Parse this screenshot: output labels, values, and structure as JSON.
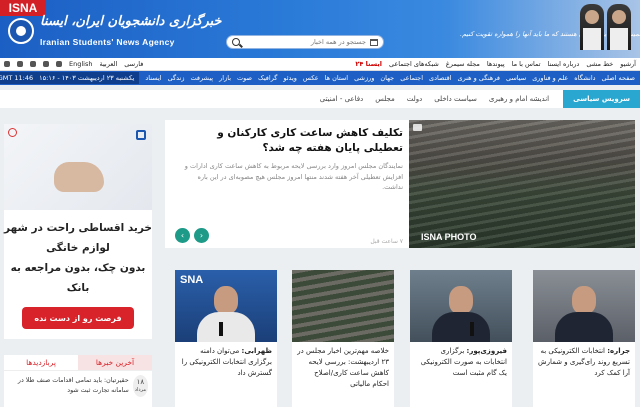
{
  "header": {
    "logo_text": "ISNA",
    "site_name_fa": "خبرگزاری دانشجویان ایران، ایسنا",
    "site_name_en": "Iranian Students' News Agency",
    "search_placeholder": "جستجو در همه اخبار",
    "quote_text": "امام خمینی (ره): اینها طوری هستند که ما باید آنها را همواره تقویت کنیم."
  },
  "top_nav": {
    "items": [
      "آرشیو",
      "خط مشی",
      "درباره ایسنا",
      "تماس با ما",
      "پیوندها",
      "مجله سیمرغ",
      "شبکه‌های اجتماعی",
      "ایسنا ۲۴"
    ],
    "langs": [
      "English",
      "العربیة",
      "فارسی"
    ]
  },
  "main_nav": {
    "items": [
      "صفحه اصلی",
      "دانشگاه",
      "علم و فناوری",
      "سیاسی",
      "فرهنگی و هنری",
      "اقتصادی",
      "اجتماعی",
      "جهان",
      "ورزشی",
      "استان ها",
      "عکس",
      "ویدئو",
      "گرافیک",
      "صوت",
      "بازار",
      "پیشرفت",
      "زندگی",
      "ایسناد"
    ],
    "date_fa": "یکشنبه ۲۳ اردیبهشت ۱۴۰۳ - ۱۵:۱۶",
    "time_gmt": "GMT 11:46"
  },
  "section": {
    "title": "سرویس سیاسی",
    "items": [
      "اندیشه امام و رهبری",
      "سیاست داخلی",
      "دولت",
      "مجلس",
      "دفاعی - امنیتی"
    ]
  },
  "featured": {
    "title": "تکلیف کاهش ساعت کاری کارکنان و تعطیلی پایان هفته چه شد؟",
    "summary": "نمایندگان مجلس امروز وارد بررسی لایحه مربوط به کاهش ساعت کاری ادارات و افزایش تعطیلی آخر هفته شدند منتها امروز مجلس هیچ مصوبه‌ای در این باره نداشت.",
    "time": "۷ ساعت قبل",
    "photo_watermark": "ISNA PHOTO"
  },
  "news_cards": [
    {
      "lead": "جراره:",
      "text": "انتخابات الکترونیکی به تسریع روند رای‌گیری و شمارش آرا کمک کرد"
    },
    {
      "lead": "فیروزی‌پور:",
      "text": "برگزاری انتخابات به صورت الکترونیکی یک گام مثبت است"
    },
    {
      "lead": "",
      "text": "خلاصه مهم‌ترین اخبار مجلس در ۲۳ اردیبهشت: بررسی لایحه کاهش ساعت کاری/اصلاح احکام مالیاتی"
    },
    {
      "lead": "ظهرابی:",
      "text": "می‌توان دامنه برگزاری انتخابات الکترونیکی را گسترش داد"
    }
  ],
  "ad": {
    "message_lines": [
      "خرید اقساطی راحت در شهر",
      "لوازم خانگی",
      "بدون چک، بدون مراجعه به",
      "بانک"
    ],
    "button": "فرصت رو از دست نده"
  },
  "tabs_box": {
    "tab_latest": "آخرین خبرها",
    "tab_popular": "پربازدیدها",
    "item_num": "۱۸",
    "item_sub": "مرداد",
    "item_text": "حقیرتیان: باید تمامی اقدامات صنف طلا در سامانه تجارت ثبت شود"
  },
  "colors": {
    "brand_blue": "#1d5fc4",
    "accent_red": "#d8232a",
    "section_teal": "#2aa7d1"
  }
}
